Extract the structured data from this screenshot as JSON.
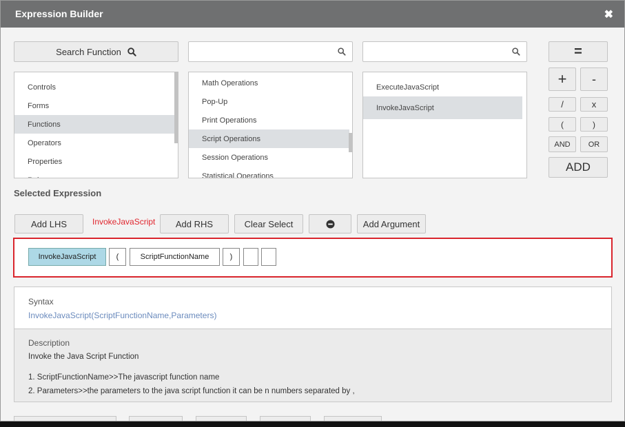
{
  "dialog": {
    "title": "Expression Builder",
    "close_icon": "close-icon"
  },
  "search": {
    "search_function_label": "Search Function",
    "search_icon": "search-icon",
    "middle_placeholder": "",
    "right_placeholder": ""
  },
  "categories": {
    "items": [
      "Controls",
      "Forms",
      "Functions",
      "Operators",
      "Properties",
      "Rules"
    ],
    "selected": "Functions"
  },
  "function_groups": {
    "items": [
      "Math Operations",
      "Pop-Up",
      "Print Operations",
      "Script Operations",
      "Session Operations",
      "Statistical Operations"
    ],
    "selected": "Script Operations"
  },
  "functions": {
    "items": [
      "ExecuteJavaScript",
      "InvokeJavaScript"
    ],
    "selected": "InvokeJavaScript"
  },
  "operators": {
    "equals": "=",
    "plus": "+",
    "minus": "-",
    "divide": "/",
    "multiply": "x",
    "open_paren": "(",
    "close_paren": ")",
    "and": "AND",
    "or": "OR",
    "add": "ADD"
  },
  "selected_expression": {
    "title": "Selected Expression",
    "add_lhs": "Add LHS",
    "current_function": "InvokeJavaScript",
    "add_rhs": "Add RHS",
    "clear_select": "Clear Select",
    "remove_icon": "minus-circle-icon",
    "add_argument": "Add Argument",
    "current_function_color": "#e0262e"
  },
  "expression_tokens": [
    "InvokeJavaScript",
    "(",
    "ScriptFunctionName",
    ")",
    "",
    ""
  ],
  "info": {
    "syntax_label": "Syntax",
    "syntax_value": "InvokeJavaScript(ScriptFunctionName,Parameters)",
    "description_label": "Description",
    "description_text": "Invoke the Java Script Function",
    "param1": "1. ScriptFunctionName>>The javascript function name",
    "param2": "2. Parameters>>the parameters to the java script function it can be n numbers separated by ,"
  },
  "colors": {
    "titlebar": "#6f7071",
    "highlight_border": "#d9242c",
    "selected_row": "#dcdfe2",
    "token_active": "#add8e6",
    "syntax_text": "#6b8bbd"
  }
}
